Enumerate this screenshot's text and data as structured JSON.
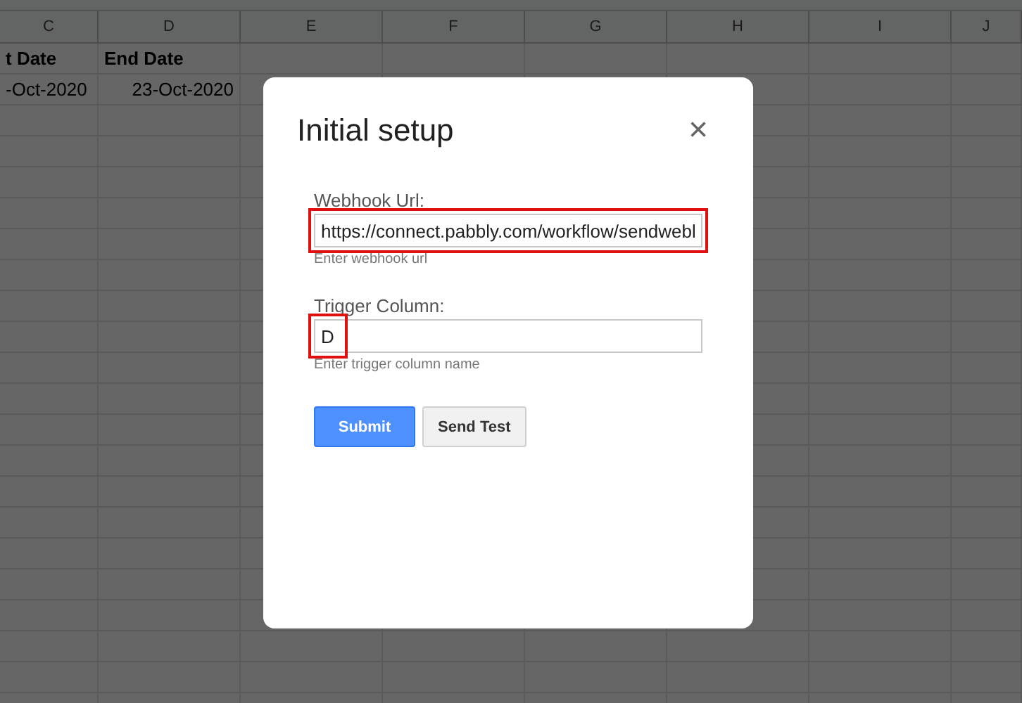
{
  "sheet": {
    "column_headers": [
      "C",
      "D",
      "E",
      "F",
      "G",
      "H",
      "I",
      "J"
    ],
    "rows": [
      [
        "t Date",
        "End Date",
        "",
        "",
        "",
        "",
        "",
        ""
      ],
      [
        "-Oct-2020",
        "23-Oct-2020",
        "",
        "",
        "",
        "",
        "",
        ""
      ]
    ]
  },
  "dialog": {
    "title": "Initial setup",
    "close": "×",
    "fields": [
      {
        "label": "Webhook Url:",
        "value": "https://connect.pabbly.com/workflow/sendwebl",
        "hint": "Enter webhook url",
        "field_framed": true,
        "value_framed": false
      },
      {
        "label": "Trigger Column:",
        "value": "D",
        "hint": "Enter trigger column name",
        "field_framed": false,
        "value_framed": true
      }
    ],
    "buttons": [
      {
        "label": "Submit",
        "kind": "primary"
      },
      {
        "label": "Send Test",
        "kind": "secondary"
      }
    ]
  }
}
